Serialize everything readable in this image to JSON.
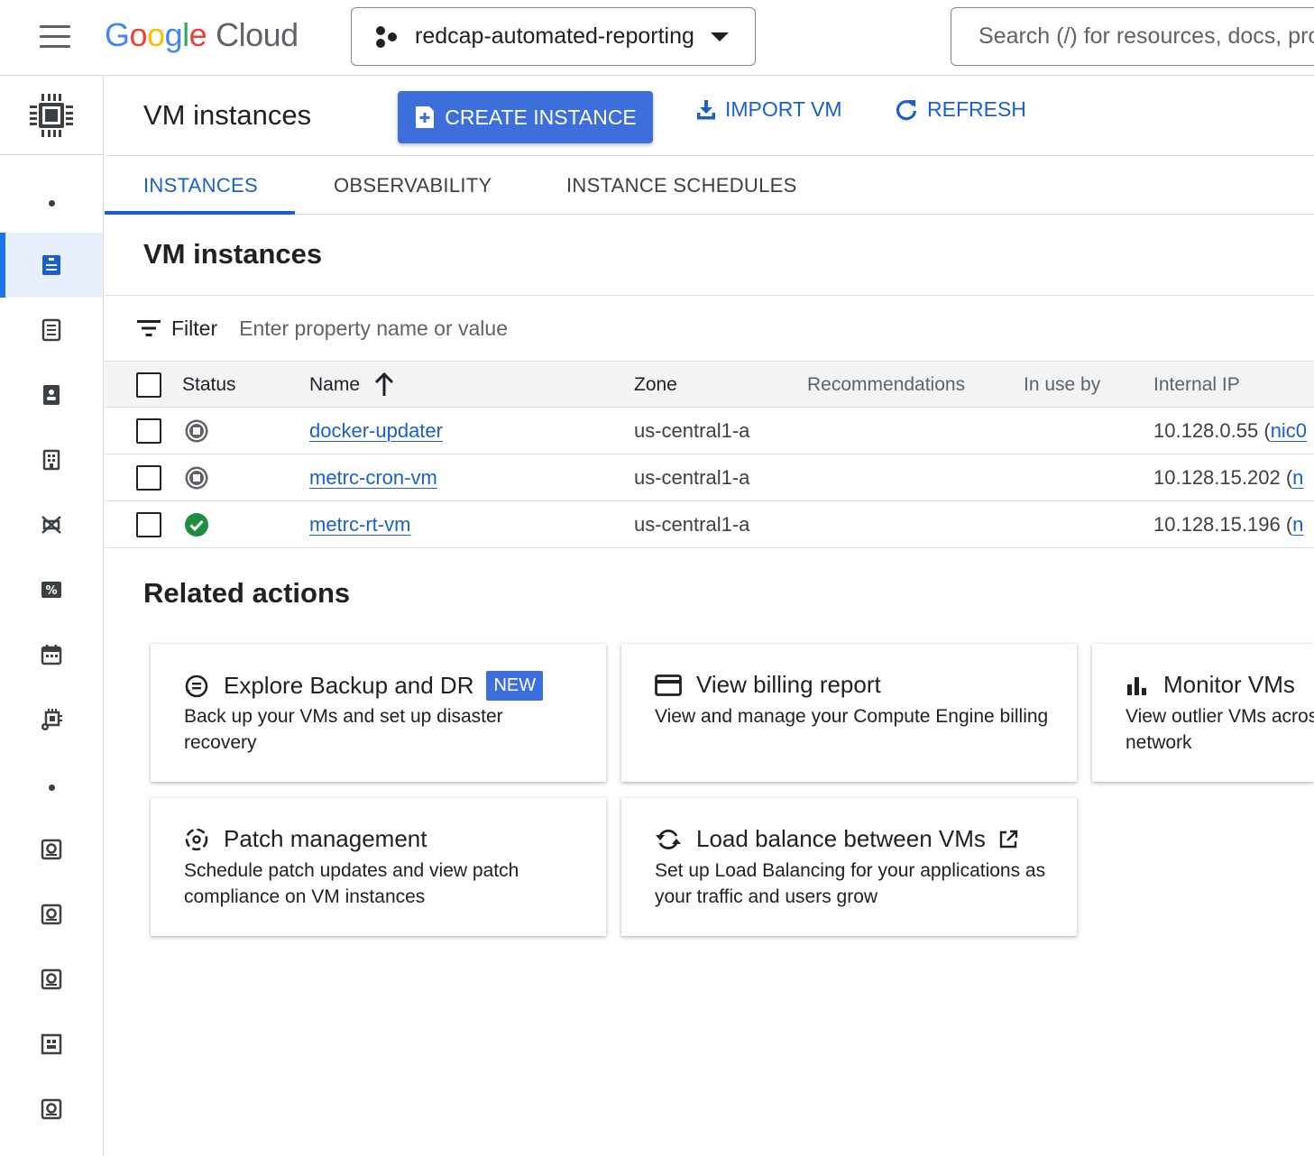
{
  "topbar": {
    "logo_google": [
      "G",
      "o",
      "o",
      "g",
      "l",
      "e"
    ],
    "logo_cloud": "Cloud",
    "project_name": "redcap-automated-reporting",
    "search_placeholder": "Search (/) for resources, docs, products, and more"
  },
  "header": {
    "title": "VM instances",
    "create_label": "CREATE INSTANCE",
    "import_label": "IMPORT VM",
    "refresh_label": "REFRESH"
  },
  "tabs": [
    {
      "label": "INSTANCES",
      "active": true
    },
    {
      "label": "OBSERVABILITY",
      "active": false
    },
    {
      "label": "INSTANCE SCHEDULES",
      "active": false
    }
  ],
  "section_title": "VM instances",
  "filter": {
    "label": "Filter",
    "placeholder": "Enter property name or value"
  },
  "table": {
    "columns": [
      "Status",
      "Name",
      "Zone",
      "Recommendations",
      "In use by",
      "Internal IP"
    ],
    "rows": [
      {
        "status": "stopped",
        "name": "docker-updater",
        "zone": "us-central1-a",
        "recommendations": "",
        "in_use_by": "",
        "ip": "10.128.0.55",
        "ip_suffix": "nic0"
      },
      {
        "status": "stopped",
        "name": "metrc-cron-vm",
        "zone": "us-central1-a",
        "recommendations": "",
        "in_use_by": "",
        "ip": "10.128.15.202",
        "ip_suffix": "n"
      },
      {
        "status": "running",
        "name": "metrc-rt-vm",
        "zone": "us-central1-a",
        "recommendations": "",
        "in_use_by": "",
        "ip": "10.128.15.196",
        "ip_suffix": "n"
      }
    ]
  },
  "related": {
    "title": "Related actions",
    "cards": [
      {
        "icon": "backup-icon",
        "title": "Explore Backup and DR",
        "badge": "NEW",
        "desc": "Back up your VMs and set up disaster recovery"
      },
      {
        "icon": "billing-card-icon",
        "title": "View billing report",
        "desc": "View and manage your Compute Engine billing"
      },
      {
        "icon": "bar-chart-icon",
        "title": "Monitor VMs",
        "desc": "View outlier VMs across CPU, disk, and network"
      },
      {
        "icon": "patch-icon",
        "title": "Patch management",
        "desc": "Schedule patch updates and view patch compliance on VM instances"
      },
      {
        "icon": "load-balance-icon",
        "title": "Load balance between VMs",
        "desc": "Set up Load Balancing for your applications as your traffic and users grow"
      }
    ]
  },
  "colors": {
    "primary": "#3c6fdc",
    "link": "#1a5fd0",
    "running": "#1e8e3e",
    "stopped": "#5f6368"
  }
}
